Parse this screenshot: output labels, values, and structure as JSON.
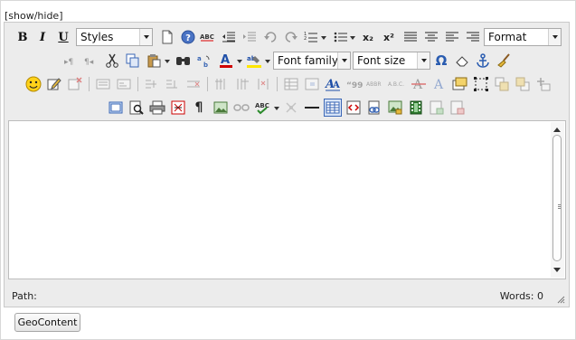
{
  "toggle": {
    "label": "[show/hide]"
  },
  "toolbar": {
    "bold": "B",
    "italic": "I",
    "underline": "U",
    "subscript": "x₂",
    "superscript": "x²",
    "styles": "Styles",
    "format": "Format",
    "font_family": "Font family",
    "font_size": "Font size",
    "omega": "Ω",
    "pilcrow": "¶"
  },
  "statusbar": {
    "path_label": "Path:",
    "words_label": "Words:",
    "words_count": "0"
  },
  "footer": {
    "button_label": "GeoContent"
  },
  "colors": {
    "toolbar_bg": "#ececec",
    "border": "#c9c9c9",
    "accent_blue": "#1f4fa8",
    "text_color_red": "#d00000",
    "highlight_yellow": "#ffe600"
  }
}
